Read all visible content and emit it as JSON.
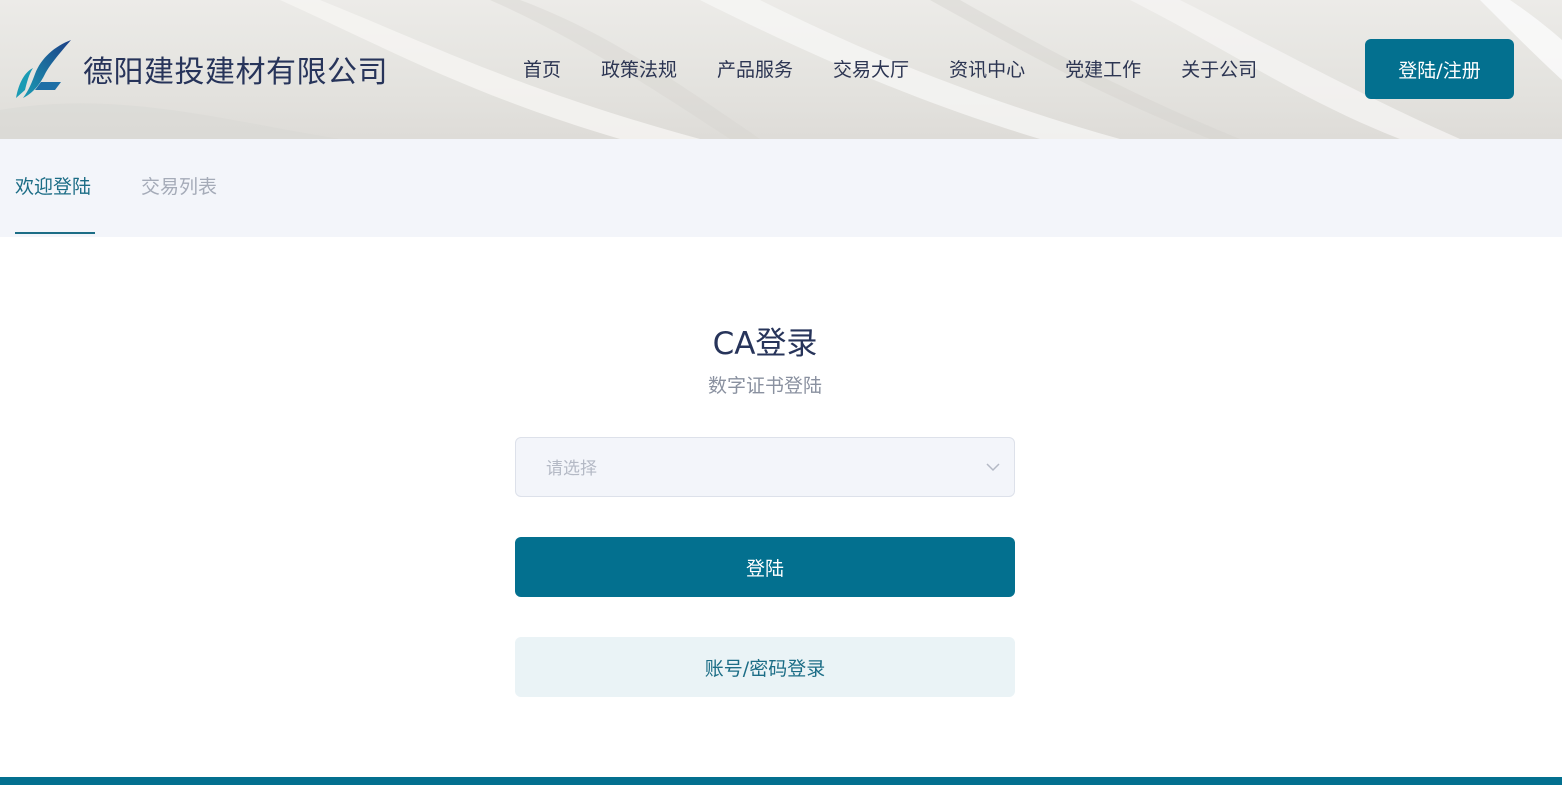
{
  "header": {
    "company_name": "德阳建投建材有限公司",
    "nav": [
      "首页",
      "政策法规",
      "产品服务",
      "交易大厅",
      "资讯中心",
      "党建工作",
      "关于公司"
    ],
    "login_register_label": "登陆/注册"
  },
  "tabs": [
    {
      "label": "欢迎登陆",
      "active": true
    },
    {
      "label": "交易列表",
      "active": false
    }
  ],
  "login_panel": {
    "title": "CA登录",
    "subtitle": "数字证书登陆",
    "certificate_select": {
      "placeholder": "请选择",
      "value": ""
    },
    "submit_label": "登陆",
    "alt_login_label": "账号/密码登录"
  },
  "colors": {
    "primary": "#03708f",
    "title_text": "#27345a",
    "subbar_bg": "#f3f5fa",
    "alt_button_bg": "#eaf3f6"
  },
  "icons": {
    "logo": "feather-wing-logo",
    "select_chevron": "chevron-down-icon"
  }
}
